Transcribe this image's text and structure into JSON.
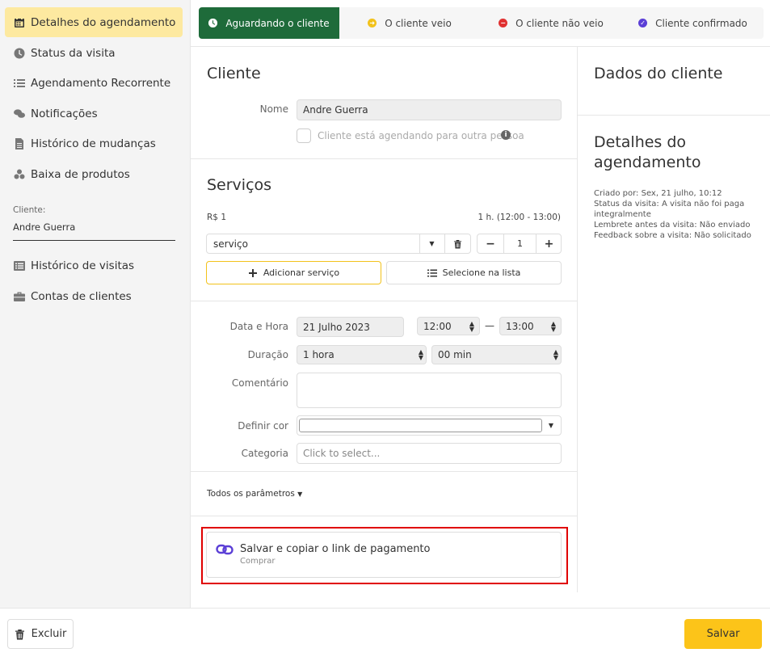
{
  "sidebar": {
    "items": [
      {
        "label": "Detalhes do agendamento",
        "icon": "calendar-icon"
      },
      {
        "label": "Status da visita",
        "icon": "clock-icon"
      },
      {
        "label": "Agendamento Recorrente",
        "icon": "list-icon"
      },
      {
        "label": "Notificações",
        "icon": "chat-icon"
      },
      {
        "label": "Histórico de mudanças",
        "icon": "document-icon"
      },
      {
        "label": "Baixa de produtos",
        "icon": "boxes-icon"
      }
    ],
    "client_label": "Cliente:",
    "client_name": "Andre Guerra",
    "bottom_items": [
      {
        "label": "Histórico de visitas",
        "icon": "history-list-icon"
      },
      {
        "label": "Contas de clientes",
        "icon": "briefcase-icon"
      }
    ]
  },
  "status": {
    "tabs": [
      {
        "label": "Aguardando o cliente",
        "color": "#1e6b3a"
      },
      {
        "label": "O cliente veio",
        "color": "#f2c21b"
      },
      {
        "label": "O cliente não veio",
        "color": "#e03131"
      },
      {
        "label": "Cliente confirmado",
        "color": "#5b3fd6"
      }
    ]
  },
  "client": {
    "title": "Cliente",
    "name_label": "Nome",
    "name_value": "Andre Guerra",
    "checkbox_label": "Cliente está agendando para outra pessoa"
  },
  "services": {
    "title": "Serviços",
    "price": "R$ 1",
    "duration_range": "1 h. (12:00 - 13:00)",
    "service_value": "serviço",
    "quantity": "1",
    "add_label": "Adicionar serviço",
    "select_label": "Selecione na lista",
    "minus": "−",
    "plus": "+"
  },
  "details": {
    "date_label": "Data e Hora",
    "date_value": "21 Julho 2023",
    "start_time": "12:00",
    "time_separator": "—",
    "end_time": "13:00",
    "duration_label": "Duração",
    "duration_hours": "1 hora",
    "duration_minutes": "00 min",
    "comment_label": "Comentário",
    "color_label": "Definir cor",
    "category_label": "Categoria",
    "category_placeholder": "Click to select..."
  },
  "params_label": "Todos os parâmetros",
  "payment": {
    "title": "Salvar e copiar o link de pagamento",
    "subtitle": "Comprar",
    "accent": "#5b3fd6",
    "highlight_color": "#e00000"
  },
  "right_panel": {
    "client_data_title": "Dados do cliente",
    "details_title": "Detalhes do agendamento",
    "created_by": "Criado por: Sex, 21 julho, 10:12",
    "visit_status": "Status da visita: A visita não foi paga integralmente",
    "reminder": "Lembrete antes da visita: Não enviado",
    "feedback": "Feedback sobre a visita: Não solicitado"
  },
  "footer": {
    "delete_label": "Excluir",
    "save_label": "Salvar",
    "save_color": "#fcc419"
  }
}
